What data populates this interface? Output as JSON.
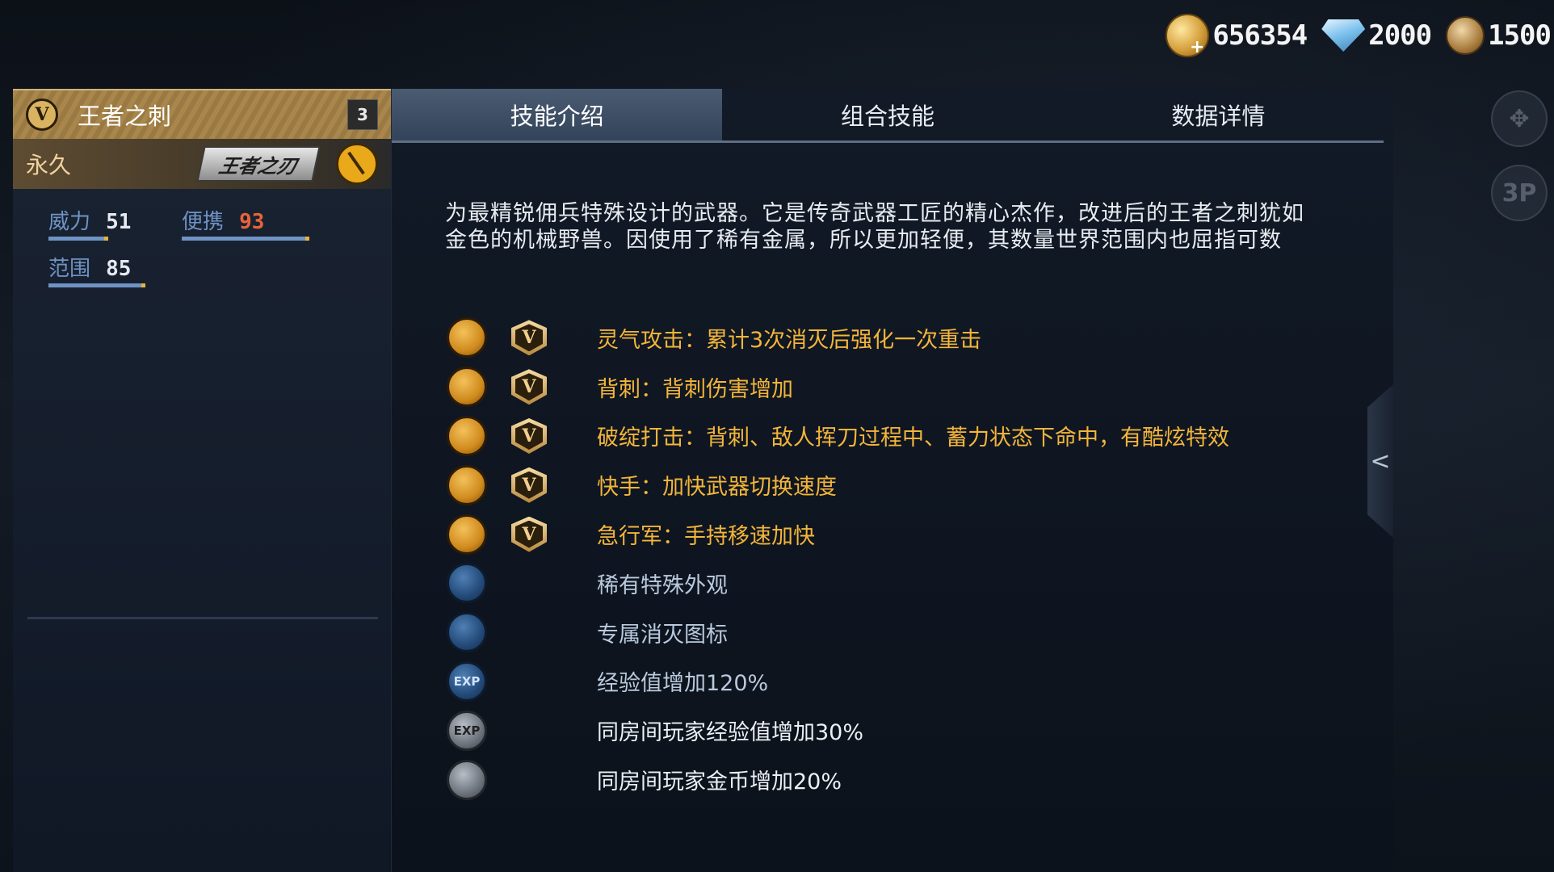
{
  "currency": [
    {
      "name": "gold",
      "icon": "gold-coin-icon",
      "value": "656354"
    },
    {
      "name": "diamond",
      "icon": "diamond-icon",
      "value": "2000"
    },
    {
      "name": "medal",
      "icon": "medal-icon",
      "value": "1500"
    }
  ],
  "weapon": {
    "name": "王者之刺",
    "tier_badge": "V",
    "level": "3",
    "duration": "永久",
    "brand_logo": "王者之刃"
  },
  "stats": [
    {
      "label": "威力",
      "value": "51",
      "fill": 0.42
    },
    {
      "label": "便携",
      "value": "93",
      "fill": 0.93
    },
    {
      "label": "范围",
      "value": "85",
      "fill": 0.7
    }
  ],
  "tabs": [
    {
      "label": "技能介绍",
      "active": true
    },
    {
      "label": "组合技能",
      "active": false
    },
    {
      "label": "数据详情",
      "active": false
    }
  ],
  "description": "为最精锐佣兵特殊设计的武器。它是传奇武器工匠的精心杰作，改进后的王者之刺犹如金色的机械野兽。因使用了稀有金属，所以更加轻便，其数量世界范围内也屈指可数",
  "skills": [
    {
      "icon": "aura-attack-icon",
      "style": "gold",
      "vip": "V",
      "text": "灵气攻击：累计3次消灭后强化一次重击"
    },
    {
      "icon": "backstab-icon",
      "style": "gold",
      "vip": "V",
      "text": "背刺：背刺伤害增加"
    },
    {
      "icon": "break-strike-icon",
      "style": "gold",
      "vip": "V",
      "text": "破绽打击：背刺、敌人挥刀过程中、蓄力状态下命中，有酷炫特效"
    },
    {
      "icon": "quick-hand-icon",
      "style": "gold",
      "vip": "V",
      "text": "快手：加快武器切换速度"
    },
    {
      "icon": "sprint-icon",
      "style": "gold",
      "vip": "V",
      "text": "急行军：手持移速加快"
    },
    {
      "icon": "star-icon",
      "style": "blue",
      "vip": "",
      "text": "稀有特殊外观"
    },
    {
      "icon": "kill-icon-badge",
      "style": "blue",
      "vip": "",
      "text": "专属消灭图标"
    },
    {
      "icon": "exp-icon",
      "style": "blue",
      "vip": "",
      "text": "经验值增加120%",
      "glyph": "EXP"
    },
    {
      "icon": "room-exp-icon",
      "style": "grey",
      "vip": "",
      "text": "同房间玩家经验值增加30%",
      "glyph": "EXP"
    },
    {
      "icon": "room-gold-icon",
      "style": "grey",
      "vip": "",
      "text": "同房间玩家金币增加20%"
    }
  ],
  "side": {
    "collapse_glyph": "<",
    "view_label": "3P"
  }
}
